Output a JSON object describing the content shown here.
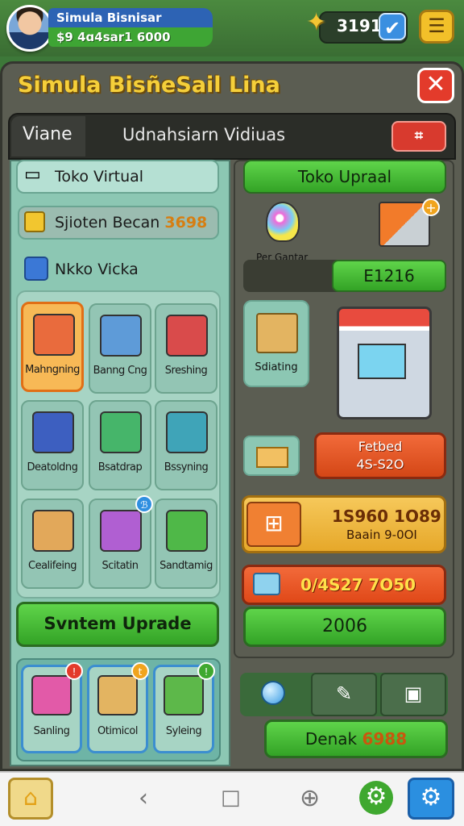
{
  "player": {
    "name": "Simula Bisnisar",
    "money": "$9 4ɑ4sar1 6000"
  },
  "topbar": {
    "coins": "3191"
  },
  "panel": {
    "title": "Simula BisñeSail Lina",
    "tabs": {
      "left": "Viane",
      "main": "Udnahsiarn Vidiuas",
      "red_icon": "⌗"
    }
  },
  "left": {
    "toko_virtual": "Toko Virtual",
    "system_label": "Sjioten Becan",
    "system_value": "3698",
    "nv_label": "Nkko Vicka",
    "tiles": [
      {
        "label": "Mahngning",
        "color": "#e96b3d"
      },
      {
        "label": "Banng Cng",
        "color": "#5e9bd8"
      },
      {
        "label": "Sreshing",
        "color": "#d94b4b"
      },
      {
        "label": "Deatoldng",
        "color": "#3d5fc0"
      },
      {
        "label": "Bsatdrap",
        "color": "#46b56a"
      },
      {
        "label": "Bssyning",
        "color": "#3fa4b8"
      },
      {
        "label": "Cealifeing",
        "color": "#e2a85a"
      },
      {
        "label": "Scitatin",
        "color": "#b05fd2"
      },
      {
        "label": "Sandtamig",
        "color": "#4fb848"
      }
    ],
    "tile_badge": "ℬ",
    "upgrade_button": "Svntem Uprade",
    "bottom_tiles": [
      {
        "label": "Sanling",
        "badge": "!"
      },
      {
        "label": "Otimicol",
        "badge": "t"
      },
      {
        "label": "Syleing",
        "badge": "!"
      }
    ]
  },
  "right": {
    "toko_upgrade": "Toko Upraal",
    "perf_label": "Per Gantar",
    "stat_value": "E1216",
    "selling_label": "Sdiating",
    "red_pill_line1": "Fetbed",
    "red_pill_line2": "4S-S2O",
    "yellow_val1": "1S960 1O89",
    "yellow_val2": "Baain 9-0OI",
    "orange_value": "0/4S27 7O50",
    "green_value": "2006",
    "donate_label": "Denak",
    "donate_value": "6988"
  },
  "colors": {
    "accent_green": "#33a326",
    "accent_red": "#e33b2b",
    "title_yellow": "#f5cf3a"
  }
}
